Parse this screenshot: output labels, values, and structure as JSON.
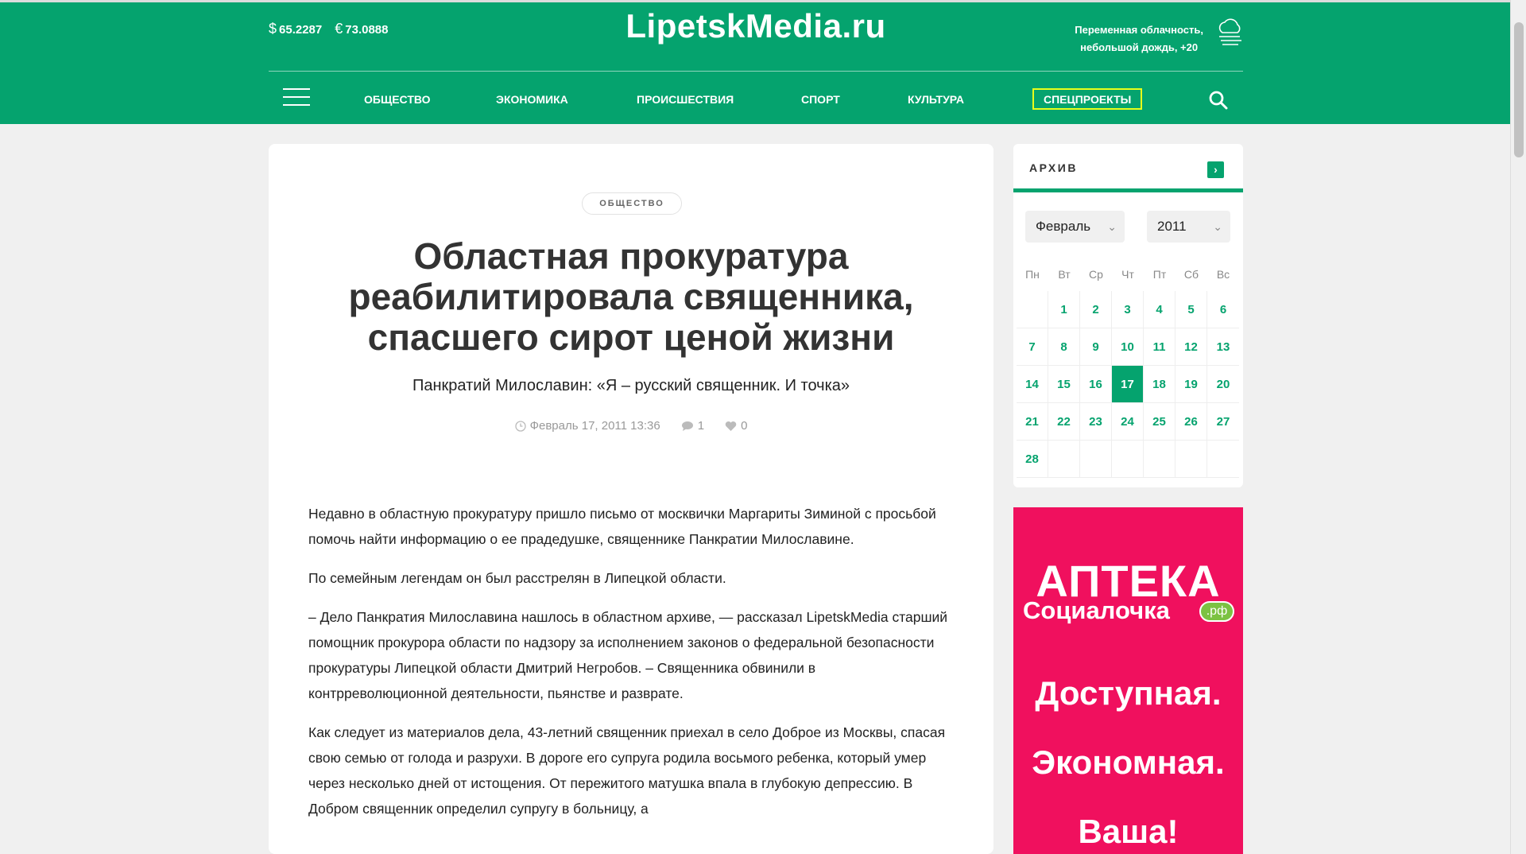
{
  "header": {
    "usd_symbol": "$",
    "usd": "65.2287",
    "eur_symbol": "€",
    "eur": "73.0888",
    "logo": "LipetskMedia.ru",
    "weather_line1": "Переменная облачность,",
    "weather_line2": "небольшой дождь, +20",
    "nav": [
      "Общество",
      "Экономика",
      "Происшествия",
      "Спорт",
      "Культура",
      "Спецпроекты"
    ]
  },
  "article": {
    "category": "ОБЩЕСТВО",
    "title": "Областная прокуратура реабилитировала священника, спасшего сирот ценой жизни",
    "subtitle": "Панкратий Милославин: «Я – русский священник. И точка»",
    "date": "Февраль 17, 2011 13:36",
    "comments": "1",
    "likes": "0",
    "paragraphs": [
      "Недавно в областную прокуратуру пришло письмо от москвички Маргариты Зиминой  с просьбой помочь найти информацию о ее прадедушке, священнике Панкратии Милославине.",
      "По семейным легендам он был расстрелян в Липецкой области.",
      " – Дело Панкратия  Милославина нашлось в областном архиве, — рассказал LipetskMedia старший помощник прокурора области по надзору за исполнением законов о федеральной безопасности прокуратуры Липецкой области Дмитрий Негробов. – Священника обвинили в контрреволюционной деятельности, пьянстве и разврате.",
      "Как следует из материалов дела, 43-летний священник приехал в село Доброе из Москвы, спасая свою семью от голода и разрухи. В дороге его супруга родила восьмого ребенка, который умер через несколько дней от истощения. От пережитого матушка впала в глубокую депрессию. В Добром священник определил супругу в больницу, а"
    ]
  },
  "archive": {
    "title": "АРХИВ",
    "arrow": "›",
    "month": "Февраль",
    "year": "2011",
    "weekdays": [
      "Пн",
      "Вт",
      "Ср",
      "Чт",
      "Пт",
      "Сб",
      "Вс"
    ],
    "weeks": [
      [
        "",
        "1",
        "2",
        "3",
        "4",
        "5",
        "6"
      ],
      [
        "7",
        "8",
        "9",
        "10",
        "11",
        "12",
        "13"
      ],
      [
        "14",
        "15",
        "16",
        "17",
        "18",
        "19",
        "20"
      ],
      [
        "21",
        "22",
        "23",
        "24",
        "25",
        "26",
        "27"
      ],
      [
        "28",
        "",
        "",
        "",
        "",
        "",
        ""
      ]
    ],
    "active_day": "17"
  },
  "ad": {
    "brand": "АПТЕКА",
    "sub": "Социалочка",
    "rf": ".рф",
    "line1": "Доступная.",
    "line2": "Экономная.",
    "line3": "Ваша!"
  },
  "colors": {
    "brand_green": "#05a36e",
    "ad_pink": "#f0105e",
    "highlight": "#e8ff1a"
  }
}
